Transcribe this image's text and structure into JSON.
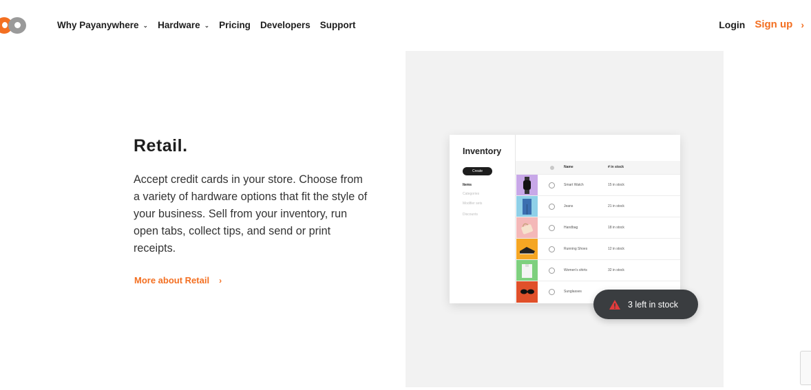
{
  "header": {
    "nav": [
      {
        "label": "Why Payanywhere",
        "dropdown": true
      },
      {
        "label": "Hardware",
        "dropdown": true
      },
      {
        "label": "Pricing",
        "dropdown": false
      },
      {
        "label": "Developers",
        "dropdown": false
      },
      {
        "label": "Support",
        "dropdown": false
      }
    ],
    "login": "Login",
    "signup": "Sign up",
    "signup_arrow": "›"
  },
  "main": {
    "title": "Retail.",
    "description": "Accept credit cards in your store. Choose from a variety of hardware options that fit the style of your business. Sell from your inventory, run open tabs, collect tips, and send or print receipts.",
    "more_link": "More about Retail",
    "more_arrow": "›"
  },
  "inventory": {
    "title": "Inventory",
    "create": "Create",
    "sidebar": [
      "Items",
      "Categories",
      "Modifier sets",
      "Discounts"
    ],
    "columns": [
      "Name",
      "# in stock"
    ],
    "rows": [
      {
        "name": "Smart Watch",
        "stock": "15 in stock",
        "color": "#c8a8e8",
        "icon": "watch-icon"
      },
      {
        "name": "Jeans",
        "stock": "21 in stock",
        "color": "#8fd0e8",
        "icon": "jeans-icon"
      },
      {
        "name": "Handbag",
        "stock": "18 in stock",
        "color": "#f4b8b8",
        "icon": "handbag-icon"
      },
      {
        "name": "Running Shoes",
        "stock": "12 in stock",
        "color": "#f5a623",
        "icon": "shoe-icon"
      },
      {
        "name": "Women's shirts",
        "stock": "32 in stock",
        "color": "#7ed07e",
        "icon": "shirt-icon"
      },
      {
        "name": "Sunglasses",
        "stock": "",
        "color": "#e0502a",
        "icon": "sunglasses-icon"
      }
    ]
  },
  "toast": {
    "text": "3 left in stock",
    "icon": "warning-icon"
  },
  "colors": {
    "brand": "#f36f21",
    "panel": "#f2f2f2",
    "toast_bg": "#3a3d40",
    "warning": "#e23b3b"
  }
}
